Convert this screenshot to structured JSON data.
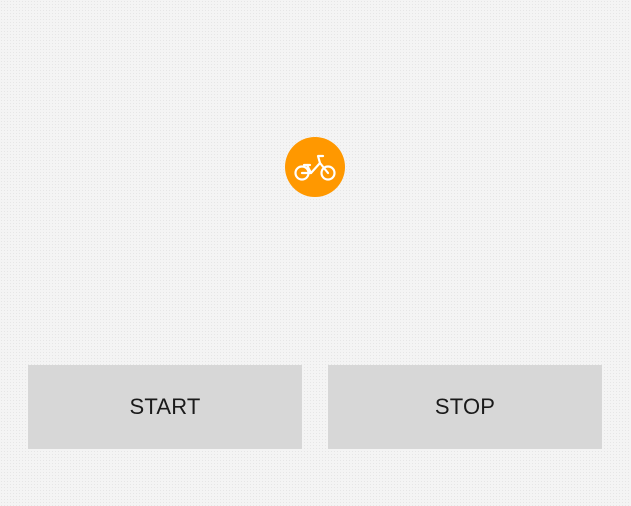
{
  "marker": {
    "icon": "bicycle-icon",
    "background_color": "#ff9800",
    "icon_color": "#ffffff"
  },
  "controls": {
    "start_label": "START",
    "stop_label": "STOP",
    "button_color": "#d7d7d7"
  }
}
